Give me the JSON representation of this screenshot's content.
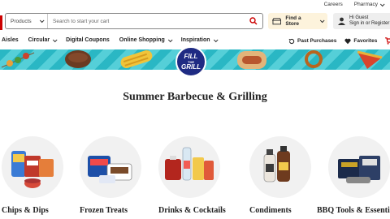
{
  "header": {
    "util_links": [
      "Careers",
      "Pharmacy"
    ],
    "search": {
      "category_value": "Products",
      "placeholder": "Search to start your cart"
    },
    "store_label": "Find a Store",
    "account": {
      "line1": "Hi Guest",
      "line2": "Sign in or Register"
    }
  },
  "nav": {
    "items": [
      "Aisles",
      "Circular",
      "Digital Coupons",
      "Online Shopping",
      "Inspiration"
    ],
    "right": {
      "past_purchases": "Past Purchases",
      "favorites": "Favorites",
      "cart": "C"
    }
  },
  "banner": {
    "logo_top": "FILL",
    "logo_small": "THE",
    "logo_bottom": "GRILL"
  },
  "page_title": "Summer Barbecue & Grilling",
  "categories": [
    {
      "label": "Chips & Dips"
    },
    {
      "label": "Frozen Treats"
    },
    {
      "label": "Drinks & Cocktails"
    },
    {
      "label": "Condiments"
    },
    {
      "label": "BBQ Tools & Essentials"
    }
  ],
  "colors": {
    "brand_red": "#cc0000",
    "banner_teal": "#2ab7c4",
    "store_bg": "#fdf3dc",
    "logo_navy": "#1f2b83"
  }
}
